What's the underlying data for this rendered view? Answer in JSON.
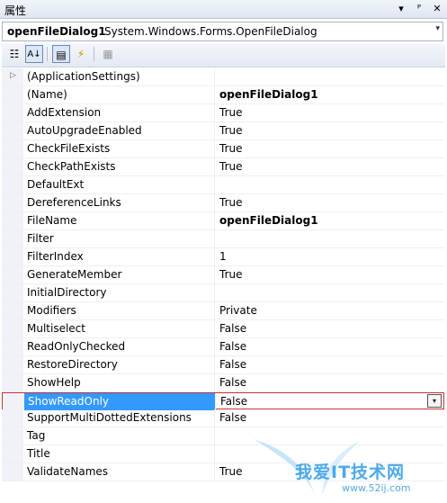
{
  "panel": {
    "title": "属性",
    "btn_dropdown": "▾",
    "btn_pin": "ᴾ",
    "btn_close": "✕"
  },
  "object_selector": {
    "name": "openFileDialog1",
    "type": "System.Windows.Forms.OpenFileDialog",
    "arrow": "▾"
  },
  "toolbar": {
    "categorized_icon": "☷",
    "alphabetical_icon": "A↓",
    "properties_icon": "▤",
    "events_icon": "⚡",
    "property_pages_icon": "▦"
  },
  "properties": [
    {
      "name": "(ApplicationSettings)",
      "value": "",
      "bold": false,
      "expandable": true
    },
    {
      "name": "(Name)",
      "value": "openFileDialog1",
      "bold": true
    },
    {
      "name": "AddExtension",
      "value": "True",
      "bold": false
    },
    {
      "name": "AutoUpgradeEnabled",
      "value": "True",
      "bold": false
    },
    {
      "name": "CheckFileExists",
      "value": "True",
      "bold": false
    },
    {
      "name": "CheckPathExists",
      "value": "True",
      "bold": false
    },
    {
      "name": "DefaultExt",
      "value": "",
      "bold": false
    },
    {
      "name": "DereferenceLinks",
      "value": "True",
      "bold": false
    },
    {
      "name": "FileName",
      "value": "openFileDialog1",
      "bold": true
    },
    {
      "name": "Filter",
      "value": "",
      "bold": false
    },
    {
      "name": "FilterIndex",
      "value": "1",
      "bold": false
    },
    {
      "name": "GenerateMember",
      "value": "True",
      "bold": false
    },
    {
      "name": "InitialDirectory",
      "value": "",
      "bold": false
    },
    {
      "name": "Modifiers",
      "value": "Private",
      "bold": false
    },
    {
      "name": "Multiselect",
      "value": "False",
      "bold": false
    },
    {
      "name": "ReadOnlyChecked",
      "value": "False",
      "bold": false
    },
    {
      "name": "RestoreDirectory",
      "value": "False",
      "bold": false
    },
    {
      "name": "ShowHelp",
      "value": "False",
      "bold": false
    },
    {
      "name": "ShowReadOnly",
      "value": "False",
      "bold": false,
      "selected": true
    },
    {
      "name": "SupportMultiDottedExtensions",
      "value": "False",
      "bold": false
    },
    {
      "name": "Tag",
      "value": "",
      "bold": false
    },
    {
      "name": "Title",
      "value": "",
      "bold": false
    },
    {
      "name": "ValidateNames",
      "value": "True",
      "bold": false
    }
  ],
  "dropdown_arrow": "▾",
  "watermark": {
    "text": "我爱IT技术网",
    "url": "www.52ij.com"
  },
  "colors": {
    "selection": "#3399ff",
    "highlight_border": "#cc3333"
  }
}
